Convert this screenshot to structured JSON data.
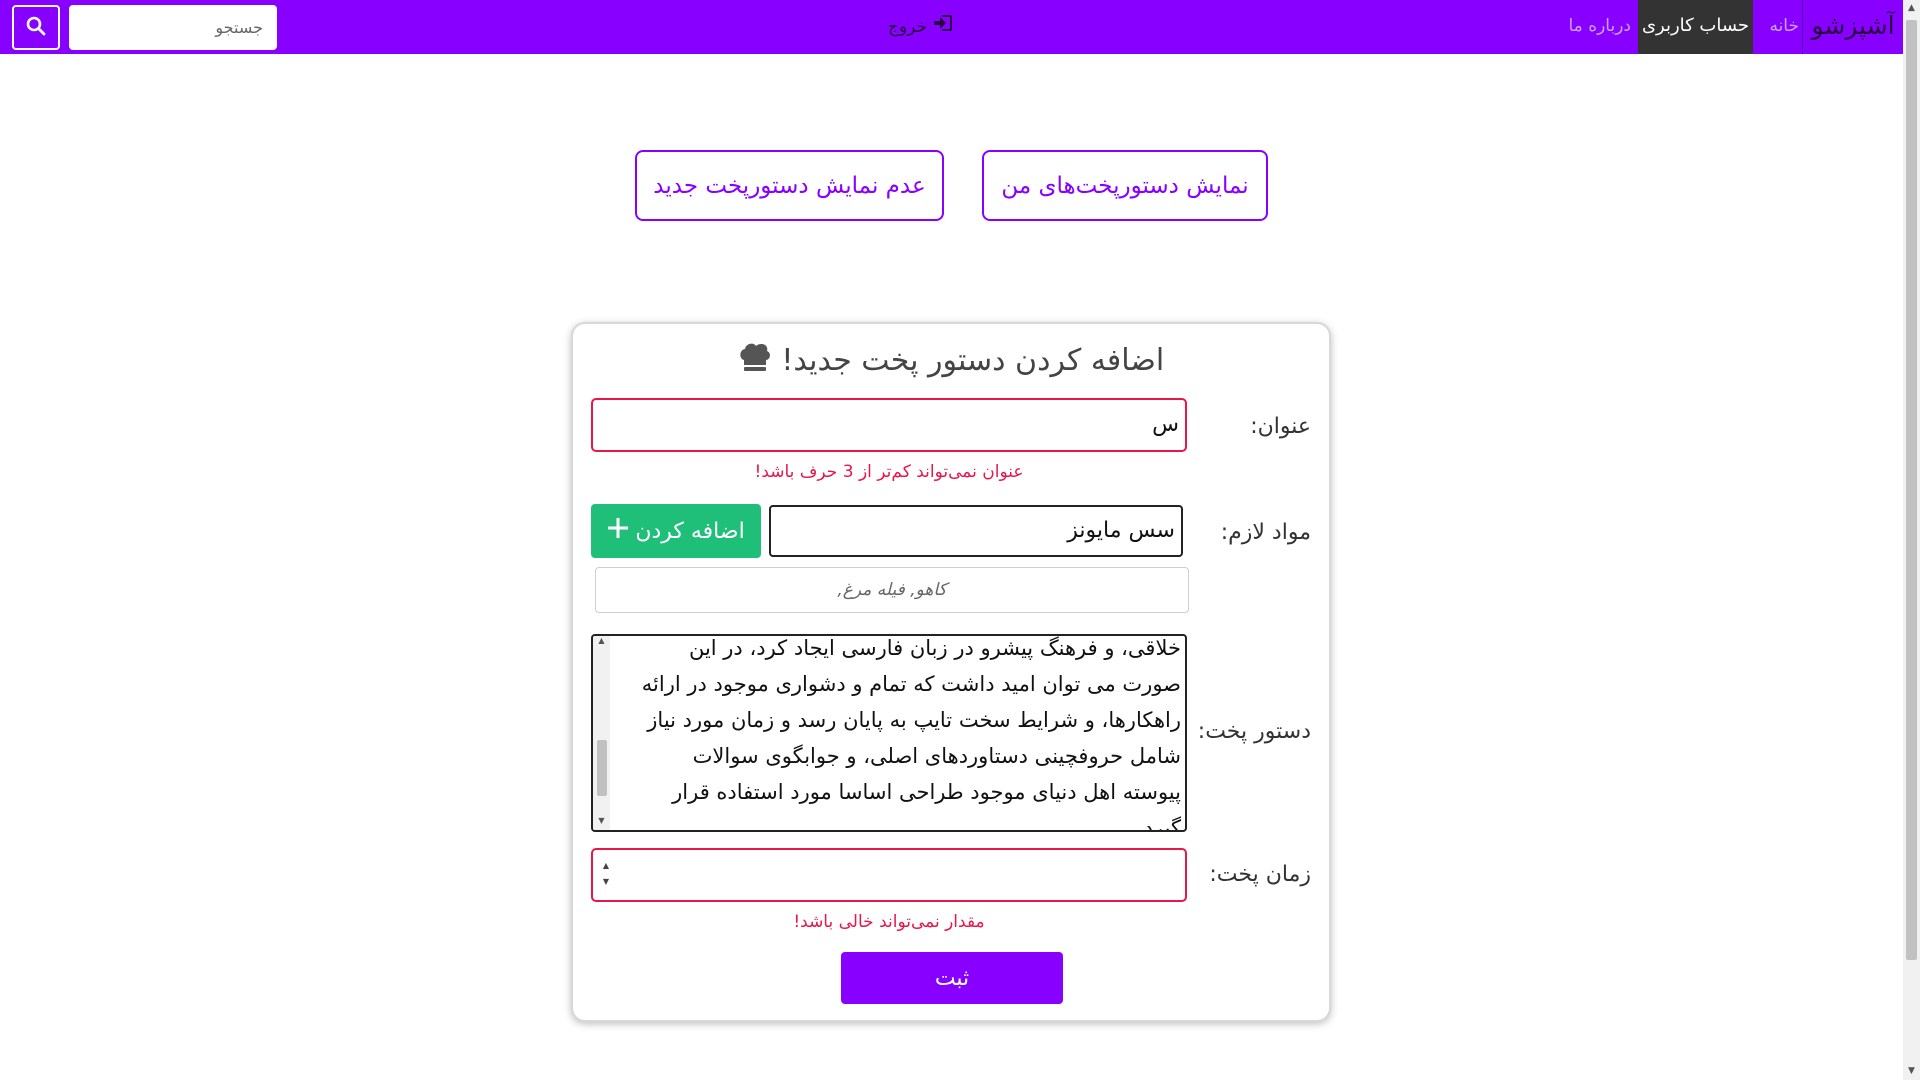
{
  "navbar": {
    "brand": "آشپزشو",
    "home": "خانه",
    "account": "حساب کاربری",
    "about": "درباره ما",
    "logout": "خروج",
    "search_placeholder": "جستجو"
  },
  "actions": {
    "show_my_recipes": "نمایش دستورپخت‌های من",
    "hide_new_recipe": "عدم نمایش دستورپخت جدید"
  },
  "form": {
    "title": "اضافه کردن دستور پخت جدید!",
    "title_label": "عنوان:",
    "title_value": "س",
    "title_error": "عنوان نمی‌تواند کم‌تر از 3 حرف باشد!",
    "ingredients_label": "مواد لازم:",
    "ingredient_input_value": "سس مایونز",
    "add_button": "اضافه کردن",
    "ingredients_placeholder": "کاهو, فیله مرغ,",
    "recipe_label": "دستور پخت:",
    "recipe_lines": [
      "خلاقی، و فرهنگ پیشرو در زبان فارسی ایجاد کرد، در این",
      "صورت می توان امید داشت که تمام و دشواری موجود در ارائه",
      "راهکارها، و شرایط سخت تایپ به پایان رسد و زمان مورد نیاز",
      "شامل حروفچینی دستاوردهای اصلی، و جوابگوی سوالات",
      "پیوسته اهل دنیای موجود طراحی اساسا مورد استفاده قرار",
      "گیرد."
    ],
    "cook_time_label": "زمان پخت:",
    "cook_time_value": "",
    "cook_time_error": "مقدار نمی‌تواند خالی باشد!",
    "submit": "ثبت"
  },
  "colors": {
    "primary": "#8800ff",
    "success": "#1fbf7a",
    "error": "#e8174a",
    "active_nav": "#333333"
  }
}
